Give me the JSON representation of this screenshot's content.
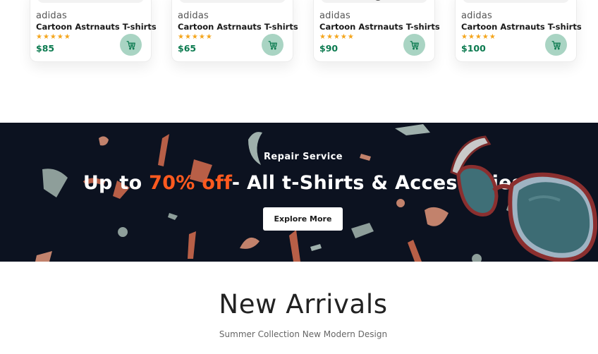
{
  "products": [
    {
      "brand": "adidas",
      "name": "Cartoon Astrnauts T-shirts",
      "rating": "★★★★★",
      "price": "$85"
    },
    {
      "brand": "adidas",
      "name": "Cartoon Astrnauts T-shirts",
      "rating": "★★★★★",
      "price": "$65"
    },
    {
      "brand": "adidas",
      "name": "Cartoon Astrnauts T-shirts",
      "rating": "★★★★★",
      "price": "$90"
    },
    {
      "brand": "adidas",
      "name": "Cartoon Astrnauts T-shirts",
      "rating": "★★★★★",
      "price": "$100"
    }
  ],
  "banner": {
    "eyebrow": "Repair Service",
    "headline_prefix": "Up to ",
    "headline_accent": "70% off",
    "headline_suffix": "- All t-Shirts & Accessories",
    "button_label": "Explore More"
  },
  "new_arrivals": {
    "title": "New Arrivals",
    "subtitle": "Summer Collection New Modern Design"
  },
  "colors": {
    "banner_bg": "#0c1220",
    "accent": "#ff5a1f",
    "price": "#0b7a4f",
    "cart_button": "#a9d4c3",
    "stars": "#f4a51c"
  },
  "icons": {
    "cart": "cart-icon"
  }
}
